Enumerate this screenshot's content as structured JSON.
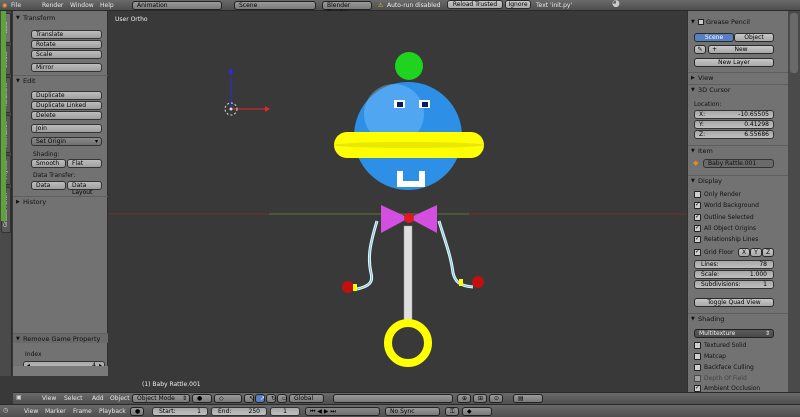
{
  "topbar": {
    "menus": [
      "File",
      "Render",
      "Window",
      "Help"
    ],
    "layout": "Animation",
    "scene": "Scene",
    "engine": "Blender Render",
    "autorun": "Auto-run disabled",
    "reload": "Reload Trusted",
    "ignore": "Ignore",
    "text_info": "Text 'init.py'"
  },
  "tooltabs": [
    "Tools",
    "Create",
    "Relations",
    "Animation",
    "Physics",
    "Grease Pencil"
  ],
  "left": {
    "transform_header": "Transform",
    "transform_buttons": [
      "Translate",
      "Rotate",
      "Scale"
    ],
    "mirror": "Mirror",
    "edit_header": "Edit",
    "edit_buttons": [
      "Duplicate",
      "Duplicate Linked",
      "Delete"
    ],
    "join": "Join",
    "set_origin": "Set Origin",
    "shading_label": "Shading:",
    "smooth": "Smooth",
    "flat": "Flat",
    "data_transfer_label": "Data Transfer:",
    "data": "Data",
    "data_layout": "Data Layout",
    "history_header": "History",
    "op_header": "Remove Game Property",
    "index_label": "Index",
    "index_value": "4"
  },
  "viewport": {
    "view_label": "User Ortho",
    "object_label": "(1) Baby Rattle.001"
  },
  "right": {
    "grease_pencil": "Grease Pencil",
    "scene_tab": "Scene",
    "object_tab": "Object",
    "new": "New",
    "new_layer": "New Layer",
    "view": "View",
    "cursor": "3D Cursor",
    "location": "Location:",
    "x_label": "X:",
    "x": "-10.65505",
    "y_label": "Y:",
    "y": "0.41298",
    "z_label": "Z:",
    "z": "6.55686",
    "item": "Item",
    "item_name": "Baby Rattle.001",
    "display": "Display",
    "only_render": "Only Render",
    "world_bg": "World Background",
    "outline_sel": "Outline Selected",
    "all_origins": "All Object Origins",
    "rel_lines": "Relationship Lines",
    "grid_floor": "Grid Floor",
    "axis_x": "X",
    "axis_y": "Y",
    "axis_z": "Z",
    "lines_label": "Lines:",
    "lines": "78",
    "scale_label": "Scale:",
    "scale": "1.000",
    "subdiv_label": "Subdivisions:",
    "subdiv": "1",
    "toggle_quad": "Toggle Quad View",
    "shading": "Shading",
    "multitexture": "Multitexture",
    "textured_solid": "Textured Solid",
    "matcap": "Matcap",
    "backface": "Backface Culling",
    "dof": "Depth Of Field",
    "ao": "Ambient Occlusion"
  },
  "vheader": {
    "view": "View",
    "select": "Select",
    "add": "Add",
    "object": "Object",
    "mode": "Object Mode",
    "orientation": "Global"
  },
  "timeline": {
    "view": "View",
    "marker": "Marker",
    "frame": "Frame",
    "playback": "Playback",
    "start_label": "Start:",
    "start": "1",
    "end_label": "End:",
    "end": "250",
    "current": "1",
    "sync": "No Sync"
  },
  "colors": {
    "accent_blue": "#5680c2",
    "ball": "#2e8fe6",
    "band": "#ffff00",
    "bow": "#d24fe0",
    "knob": "#1fd41f"
  }
}
